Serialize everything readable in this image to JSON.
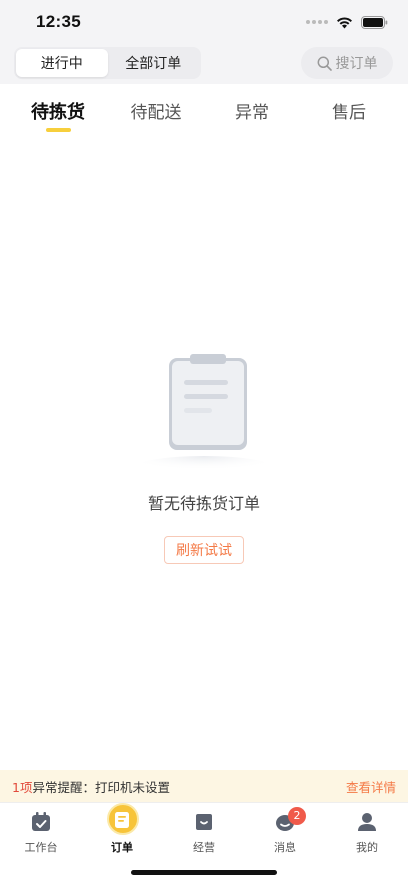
{
  "status_bar": {
    "time": "12:35"
  },
  "header": {
    "segments": [
      {
        "label": "进行中",
        "active": true
      },
      {
        "label": "全部订单",
        "active": false
      }
    ],
    "search": {
      "placeholder": "搜订单"
    }
  },
  "tabs": [
    {
      "label": "待拣货",
      "active": true
    },
    {
      "label": "待配送",
      "active": false
    },
    {
      "label": "异常",
      "active": false
    },
    {
      "label": "售后",
      "active": false
    }
  ],
  "empty_state": {
    "message": "暂无待拣货订单",
    "button_label": "刷新试试"
  },
  "alert_bar": {
    "count": "1项",
    "text": "异常提醒：打印机未设置",
    "link": "查看详情"
  },
  "bottom_nav": {
    "items": [
      {
        "label": "工作台",
        "icon": "workbench-icon"
      },
      {
        "label": "订单",
        "icon": "orders-icon",
        "active": true
      },
      {
        "label": "经营",
        "icon": "business-icon"
      },
      {
        "label": "消息",
        "icon": "message-icon",
        "badge": "2"
      },
      {
        "label": "我的",
        "icon": "profile-icon"
      }
    ]
  },
  "colors": {
    "accent_yellow": "#f7cf3c",
    "accent_orange": "#f47a47",
    "badge_red": "#f05a4a"
  }
}
